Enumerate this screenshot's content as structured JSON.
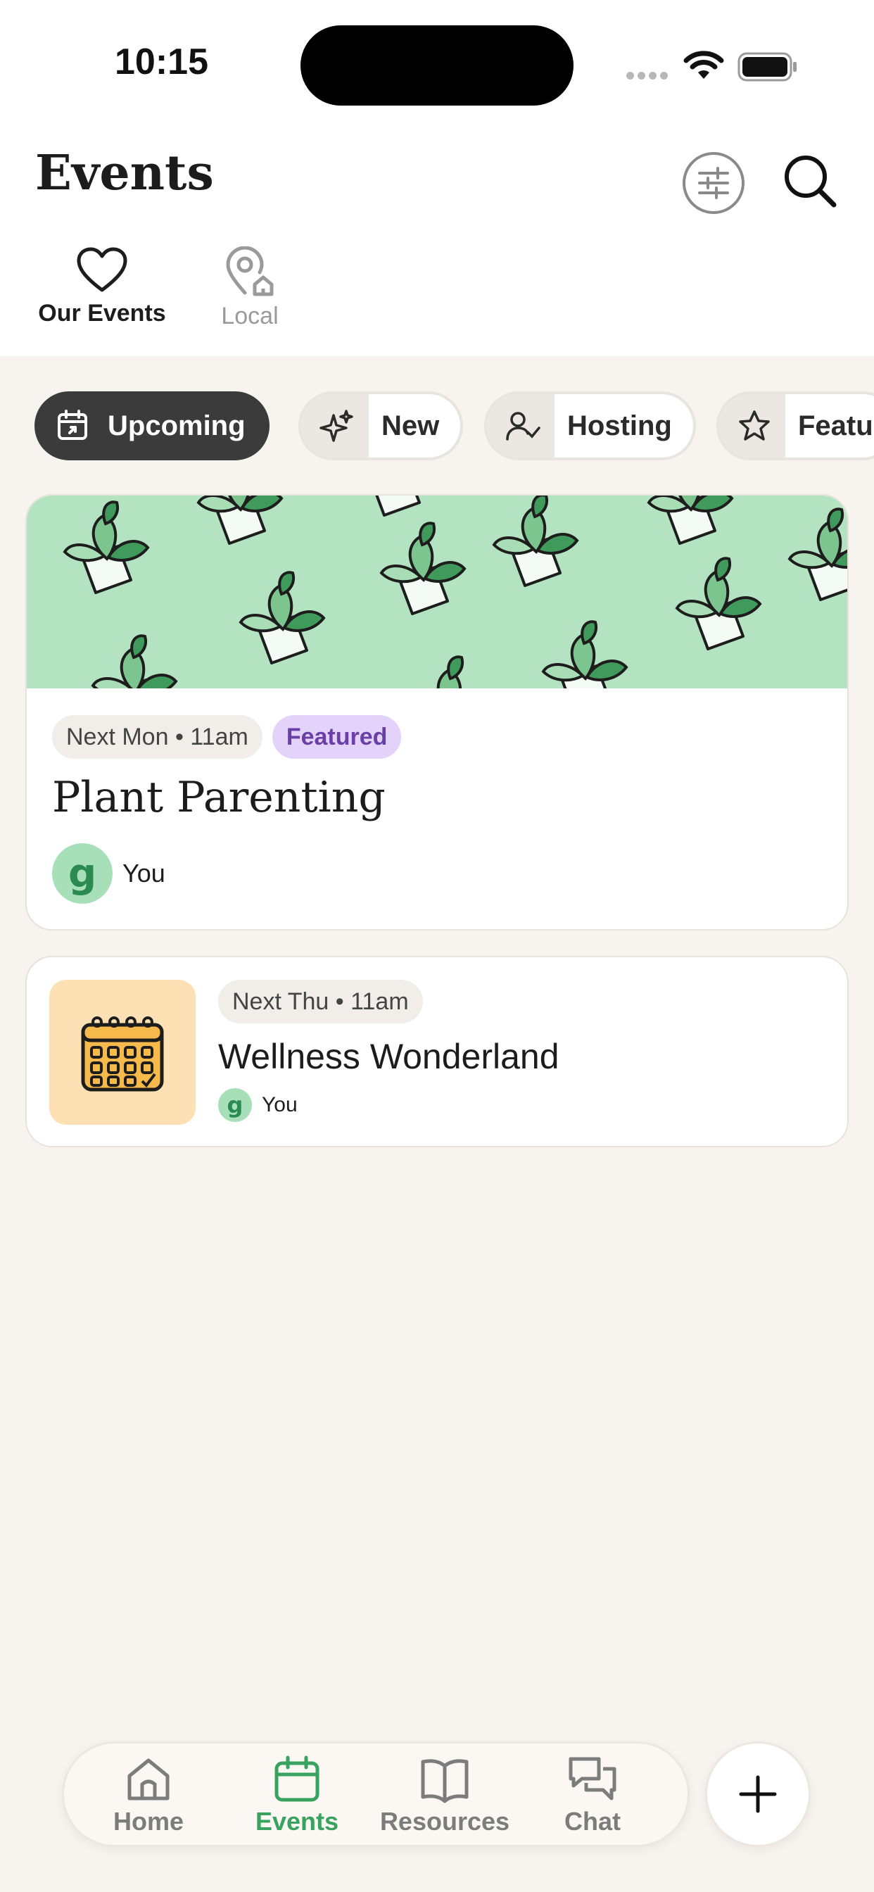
{
  "status_bar": {
    "time": "10:15"
  },
  "header": {
    "title": "Events"
  },
  "view_tabs": [
    {
      "label": "Our Events",
      "active": true
    },
    {
      "label": "Local",
      "active": false
    }
  ],
  "filters": [
    {
      "label": "Upcoming",
      "icon": "calendar-icon",
      "active": true
    },
    {
      "label": "New",
      "icon": "sparkle-icon",
      "active": false
    },
    {
      "label": "Hosting",
      "icon": "user-check-icon",
      "active": false
    },
    {
      "label": "Featu",
      "icon": "star-icon",
      "active": false
    }
  ],
  "events": [
    {
      "date": "Next Mon • 11am",
      "badge": "Featured",
      "title": "Plant Parenting",
      "host": "You",
      "host_avatar_letter": "g"
    },
    {
      "date": "Next Thu • 11am",
      "title": "Wellness Wonderland",
      "host": "You",
      "host_avatar_letter": "g"
    }
  ],
  "bottom_nav": [
    {
      "label": "Home",
      "icon": "home-icon",
      "active": false
    },
    {
      "label": "Events",
      "icon": "calendar-icon",
      "active": true
    },
    {
      "label": "Resources",
      "icon": "book-icon",
      "active": false
    },
    {
      "label": "Chat",
      "icon": "chat-icon",
      "active": false
    }
  ],
  "colors": {
    "background": "#f7f4ef",
    "accent_green": "#3aa25f",
    "featured_purple": "#6b3fa8",
    "chip_active": "#3b3b3b",
    "banner_green": "#b3e3c1"
  }
}
